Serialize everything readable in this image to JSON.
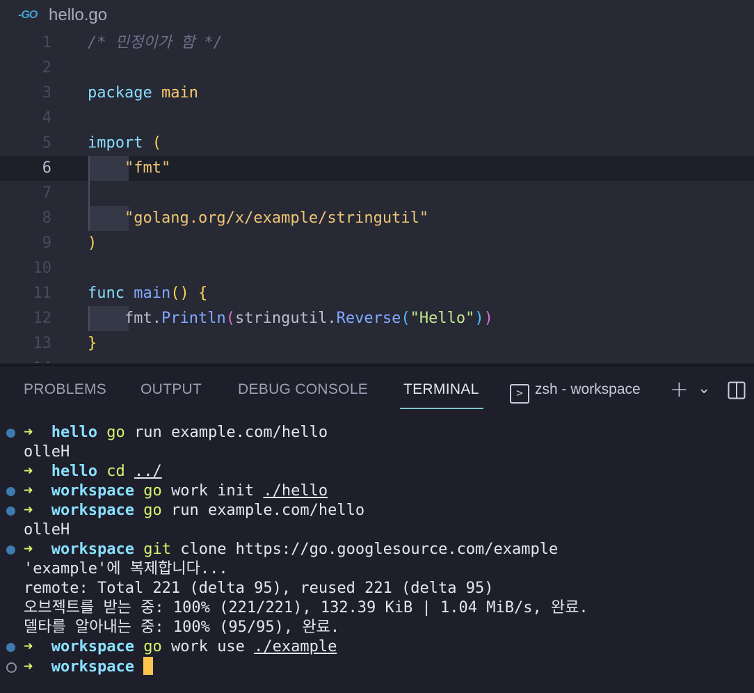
{
  "editor": {
    "tab": {
      "icon": "go-icon",
      "icon_text": "-GO",
      "filename": "hello.go"
    },
    "current_line": 6,
    "lines": [
      {
        "n": "1",
        "t": [
          {
            "c": "comment",
            "s": "/* 민정이가 함 */"
          }
        ]
      },
      {
        "n": "2",
        "t": []
      },
      {
        "n": "3",
        "t": [
          {
            "c": "kw",
            "s": "package "
          },
          {
            "c": "id",
            "s": "main"
          }
        ]
      },
      {
        "n": "4",
        "t": []
      },
      {
        "n": "5",
        "t": [
          {
            "c": "kw",
            "s": "import "
          },
          {
            "c": "paren",
            "s": "("
          }
        ]
      },
      {
        "n": "6",
        "indent": true,
        "t": [
          {
            "c": "plain",
            "s": "    "
          },
          {
            "c": "str",
            "s": "\"fmt\""
          }
        ]
      },
      {
        "n": "7",
        "guide": true,
        "t": []
      },
      {
        "n": "8",
        "indent": true,
        "t": [
          {
            "c": "plain",
            "s": "    "
          },
          {
            "c": "str",
            "s": "\"golang.org/x/example/stringutil\""
          }
        ]
      },
      {
        "n": "9",
        "t": [
          {
            "c": "paren",
            "s": ")"
          }
        ]
      },
      {
        "n": "10",
        "t": []
      },
      {
        "n": "11",
        "t": [
          {
            "c": "kw",
            "s": "func "
          },
          {
            "c": "fn",
            "s": "main"
          },
          {
            "c": "paren",
            "s": "() {"
          }
        ]
      },
      {
        "n": "12",
        "indent": true,
        "t": [
          {
            "c": "plain",
            "s": "    fmt."
          },
          {
            "c": "fn",
            "s": "Println"
          },
          {
            "c": "paren2",
            "s": "("
          },
          {
            "c": "plain",
            "s": "stringutil."
          },
          {
            "c": "fn",
            "s": "Reverse"
          },
          {
            "c": "paren3",
            "s": "("
          },
          {
            "c": "str2",
            "s": "\"Hello\""
          },
          {
            "c": "paren3",
            "s": ")"
          },
          {
            "c": "paren2",
            "s": ")"
          }
        ]
      },
      {
        "n": "13",
        "t": [
          {
            "c": "paren",
            "s": "}"
          }
        ]
      },
      {
        "n": "14",
        "t": []
      }
    ]
  },
  "panel": {
    "tabs": [
      {
        "label": "PROBLEMS",
        "active": false
      },
      {
        "label": "OUTPUT",
        "active": false
      },
      {
        "label": "DEBUG CONSOLE",
        "active": false
      },
      {
        "label": "TERMINAL",
        "active": true
      }
    ],
    "terminal_selector": {
      "icon": "terminal-icon",
      "icon_glyph": ">",
      "label": "zsh - workspace"
    },
    "actions": [
      {
        "name": "new-terminal-button",
        "icon": "plus-icon",
        "glyph": "+"
      },
      {
        "name": "terminal-dropdown-button",
        "icon": "chevron-down-icon",
        "glyph": "⌄"
      },
      {
        "name": "split-terminal-button",
        "icon": "split-panel-icon",
        "glyph": "◫"
      }
    ]
  },
  "terminal": {
    "prompt_arrow": "➜",
    "lines": [
      {
        "type": "cmd",
        "dot": "filled",
        "dir": "hello",
        "cmd": "go",
        "args": [
          {
            "s": " run example.com/hello"
          }
        ]
      },
      {
        "type": "out",
        "text": "olleH"
      },
      {
        "type": "cmd",
        "dot": "none",
        "dir": "hello",
        "cmd": "cd",
        "args": [
          {
            "s": " "
          },
          {
            "s": "../",
            "u": true
          }
        ]
      },
      {
        "type": "cmd",
        "dot": "filled",
        "dir": "workspace",
        "cmd": "go",
        "args": [
          {
            "s": " work init "
          },
          {
            "s": "./hello",
            "u": true
          }
        ]
      },
      {
        "type": "cmd",
        "dot": "filled",
        "dir": "workspace",
        "cmd": "go",
        "args": [
          {
            "s": " run example.com/hello"
          }
        ]
      },
      {
        "type": "out",
        "text": "olleH"
      },
      {
        "type": "cmd",
        "dot": "filled",
        "dir": "workspace",
        "cmd": "git",
        "args": [
          {
            "s": " clone https://go.googlesource.com/example"
          }
        ]
      },
      {
        "type": "out",
        "text": "'example'에 복제합니다..."
      },
      {
        "type": "out",
        "text": "remote: Total 221 (delta 95), reused 221 (delta 95)"
      },
      {
        "type": "out",
        "text": "오브젝트를 받는 중: 100% (221/221), 132.39 KiB | 1.04 MiB/s, 완료."
      },
      {
        "type": "out",
        "text": "델타를 알아내는 중: 100% (95/95), 완료."
      },
      {
        "type": "cmd",
        "dot": "filled",
        "dir": "workspace",
        "cmd": "go",
        "args": [
          {
            "s": " work use "
          },
          {
            "s": "./example",
            "u": true
          }
        ]
      },
      {
        "type": "cmd",
        "dot": "empty",
        "dir": "workspace",
        "cmd": "",
        "args": [],
        "cursor": true
      }
    ]
  }
}
